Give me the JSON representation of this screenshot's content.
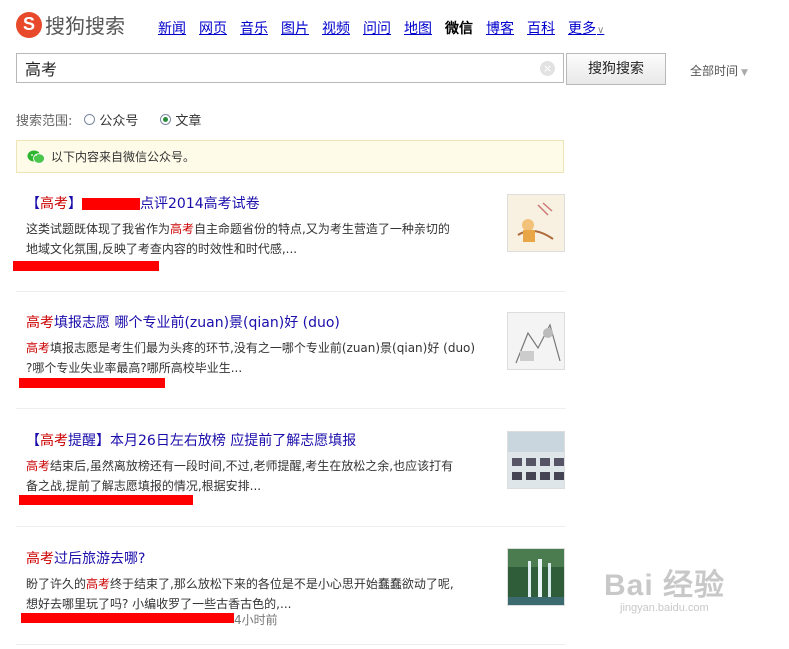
{
  "logo": {
    "badge": "S",
    "text": "搜狗搜索"
  },
  "nav": [
    {
      "label": "新闻",
      "active": false
    },
    {
      "label": "网页",
      "active": false
    },
    {
      "label": "音乐",
      "active": false
    },
    {
      "label": "图片",
      "active": false
    },
    {
      "label": "视频",
      "active": false
    },
    {
      "label": "问问",
      "active": false
    },
    {
      "label": "地图",
      "active": false
    },
    {
      "label": "微信",
      "active": true
    },
    {
      "label": "博客",
      "active": false
    },
    {
      "label": "百科",
      "active": false
    },
    {
      "label": "更多",
      "active": false
    }
  ],
  "search": {
    "value": "高考",
    "button": "搜狗搜索",
    "clear": "×"
  },
  "time_filter": {
    "label": "全部时间"
  },
  "scope": {
    "label": "搜索范围:",
    "options": [
      {
        "label": "公众号",
        "checked": false
      },
      {
        "label": "文章",
        "checked": true
      }
    ]
  },
  "notice": {
    "text": "以下内容来自微信公众号。"
  },
  "results": [
    {
      "title_parts": [
        "【",
        "高考",
        "】",
        "点评2014",
        "高考",
        "试卷"
      ],
      "desc_line1_pre": "这类试题既体现了我省作为",
      "desc_hl": "高考",
      "desc_line1_post": "自主命题省份的特点,又为考生营造了一种亲切的",
      "desc_line2": "地域文化氛围,反映了考查内容的时效性和时代感,..."
    },
    {
      "title_hl": "高考",
      "title_rest": "填报志愿 哪个专业前(zuan)景(qian)好 (duo)",
      "desc_hl": "高考",
      "desc_line1_post": "填报志愿是考生们最为头疼的环节,没有之一哪个专业前(zuan)景(qian)好 (duo)",
      "desc_line2": "?哪个专业失业率最高?哪所高校毕业生..."
    },
    {
      "title_parts": [
        "【",
        "高考",
        "提醒】本月26日左右放榜 应提前了解志愿填报"
      ],
      "desc_hl": "高考",
      "desc_line1_post": "结束后,虽然离放榜还有一段时间,不过,老师提醒,考生在放松之余,也应该打有",
      "desc_line2": "备之战,提前了解志愿填报的情况,根据安排..."
    },
    {
      "title_hl": "高考",
      "title_rest": "过后旅游去哪?",
      "desc_line1_pre": "盼了许久的",
      "desc_hl": "高考",
      "desc_line1_post": "终于结束了,那么放松下来的各位是不是小心思开始蠢蠢欲动了呢,",
      "desc_line2": "想好去哪里玩了吗? 小编收罗了一些古香古色的,...",
      "meta_time": "4小时前"
    }
  ],
  "watermark": {
    "main": "Bai 经验",
    "sub": "jingyan.baidu.com"
  },
  "colors": {
    "link": "#0000cc",
    "highlight": "#cc0000",
    "redaction": "#ff0000",
    "logo": "#e8492a"
  }
}
